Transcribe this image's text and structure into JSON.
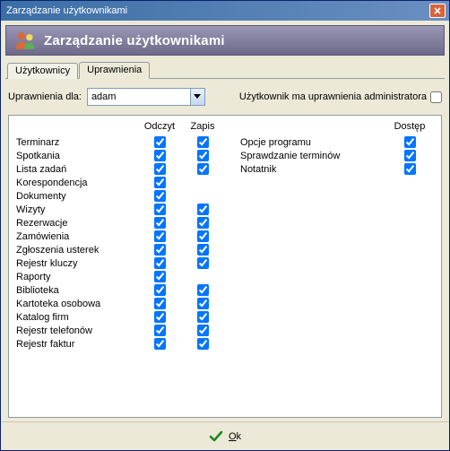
{
  "window": {
    "title": "Zarządzanie użytkownikami"
  },
  "header": {
    "title": "Zarządzanie użytkownikami"
  },
  "tabs": {
    "users": "Użytkownicy",
    "permissions": "Uprawnienia"
  },
  "form": {
    "permissions_for_label": "Uprawnienia dla:",
    "selected_user": "adam",
    "admin_label": "Użytkownik ma uprawnienia administratora",
    "admin_checked": false
  },
  "columns": {
    "read": "Odczyt",
    "write": "Zapis",
    "access": "Dostęp"
  },
  "left_rows": [
    {
      "label": "Terminarz",
      "read": true,
      "write": true
    },
    {
      "label": "Spotkania",
      "read": true,
      "write": true
    },
    {
      "label": "Lista zadań",
      "read": true,
      "write": true
    },
    {
      "label": "Korespondencja",
      "read": true,
      "write": false,
      "write_hidden": true
    },
    {
      "label": "Dokumenty",
      "read": true,
      "write": false,
      "write_hidden": true
    },
    {
      "label": "Wizyty",
      "read": true,
      "write": true
    },
    {
      "label": "Rezerwacje",
      "read": true,
      "write": true
    },
    {
      "label": "Zamówienia",
      "read": true,
      "write": true
    },
    {
      "label": "Zgłoszenia usterek",
      "read": true,
      "write": true
    },
    {
      "label": "Rejestr kluczy",
      "read": true,
      "write": true
    },
    {
      "label": "Raporty",
      "read": true,
      "write": false,
      "write_hidden": true
    },
    {
      "label": "Biblioteka",
      "read": true,
      "write": true
    },
    {
      "label": "Kartoteka osobowa",
      "read": true,
      "write": true
    },
    {
      "label": "Katalog firm",
      "read": true,
      "write": true
    },
    {
      "label": "Rejestr telefonów",
      "read": true,
      "write": true
    },
    {
      "label": "Rejestr faktur",
      "read": true,
      "write": true
    }
  ],
  "right_rows": [
    {
      "label": "Opcje programu",
      "access": true
    },
    {
      "label": "Sprawdzanie terminów",
      "access": true
    },
    {
      "label": "Notatnik",
      "access": true
    }
  ],
  "footer": {
    "ok_prefix": "O",
    "ok_rest": "k"
  }
}
